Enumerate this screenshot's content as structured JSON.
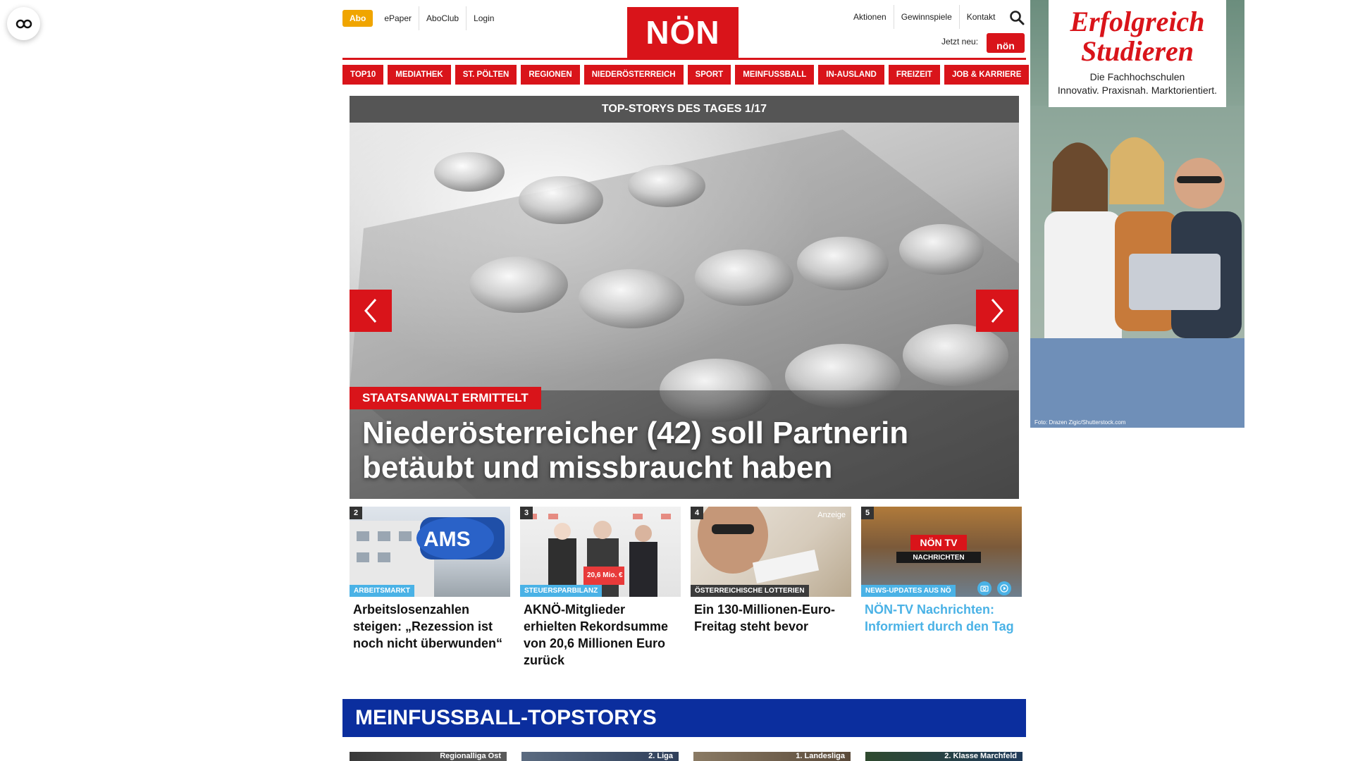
{
  "accessibility": {
    "icon": "glasses-icon"
  },
  "header": {
    "abo_label": "Abo",
    "left_links": [
      "ePaper",
      "AboClub",
      "Login"
    ],
    "logo_text": "NÖN",
    "right_links": [
      "Aktionen",
      "Gewinnspiele",
      "Kontakt"
    ],
    "jetzt_neu": "Jetzt neu:",
    "promo_badge_text": "nön"
  },
  "nav": {
    "items": [
      "TOP10",
      "MEDIATHEK",
      "ST. PÖLTEN",
      "REGIONEN",
      "NIEDERÖSTERREICH",
      "SPORT",
      "MEINFUSSBALL",
      "IN-AUSLAND",
      "FREIZEIT",
      "JOB & KARRIERE"
    ]
  },
  "slider": {
    "heading": "TOP-STORYS DES TAGES 1/17",
    "tag": "STAATSANWALT ERMITTELT",
    "title": "Niederösterreicher (42) soll Partnerin betäubt und missbraucht haben"
  },
  "stories": [
    {
      "number": "2",
      "category": "ARBEITSMARKT",
      "title": "Arbeitslosenzahlen steigen: „Rezession ist noch nicht überwunden“"
    },
    {
      "number": "3",
      "category": "STEUERSPARBILANZ",
      "title": "AKNÖ-Mitglieder erhielten Rekordsumme von 20,6 Millionen Euro zurück"
    },
    {
      "number": "4",
      "category": "ÖSTERREICHISCHE LOTTERIEN",
      "ad_label": "Anzeige",
      "title": "Ein 130-Millionen-Euro-Freitag steht bevor"
    },
    {
      "number": "5",
      "category": "NEWS-UPDATES AUS NÖ",
      "title": "NÖN-TV Nachrichten: Informiert durch den Tag"
    }
  ],
  "meinfussball": {
    "heading": "MEINFUSSBALL-TOPSTORYS",
    "cards": [
      "Regionalliga Ost",
      "2. Liga",
      "1. Landesliga",
      "2. Klasse Marchfeld"
    ]
  },
  "ad": {
    "title_line1": "Erfolgreich",
    "title_line2": "Studieren",
    "subtitle_line1": "Die Fachhochschulen",
    "subtitle_line2": "Innovativ. Praxisnah. Marktorientiert.",
    "credit": "Foto: Drazen Zigic/Shutterstock.com"
  },
  "colors": {
    "brand_red": "#d9141a",
    "accent_blue": "#4ab2e6",
    "mf_blue": "#0b2e9e",
    "abo_orange": "#f0a500"
  }
}
